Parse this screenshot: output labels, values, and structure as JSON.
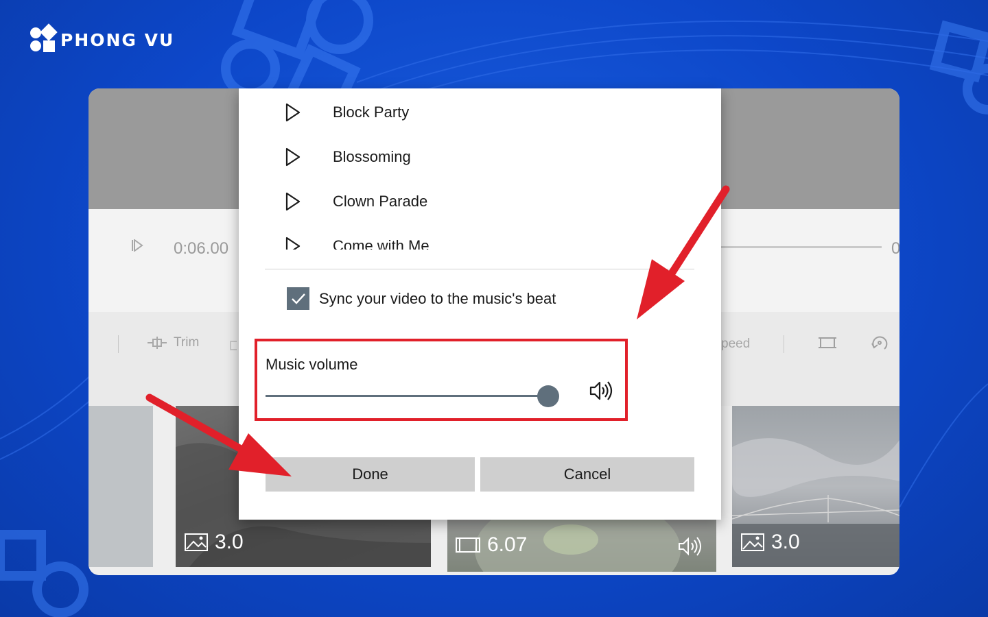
{
  "brand": {
    "name": "PHONG VU"
  },
  "app": {
    "playback": {
      "current_time": "0:06.00",
      "end_time_partial": "0"
    },
    "toolbar": {
      "trim_label": "Trim",
      "speed_label_partial": "peed"
    },
    "storyboard": [
      {
        "duration": "3.0",
        "kind": "image"
      },
      {
        "duration": "6.07",
        "kind": "video"
      },
      {
        "duration": "3.0",
        "kind": "image"
      }
    ]
  },
  "music_dialog": {
    "tracks": [
      {
        "name": "Block Party"
      },
      {
        "name": "Blossoming"
      },
      {
        "name": "Clown Parade"
      },
      {
        "name": "Come with Me"
      }
    ],
    "sync_label": "Sync your video to the music's beat",
    "sync_checked": true,
    "volume_label": "Music volume",
    "volume_value": 0.96,
    "done_label": "Done",
    "cancel_label": "Cancel"
  },
  "colors": {
    "accent": "#5f6f7c",
    "annotation_red": "#e1202a",
    "background_blue": "#0d47c9"
  }
}
